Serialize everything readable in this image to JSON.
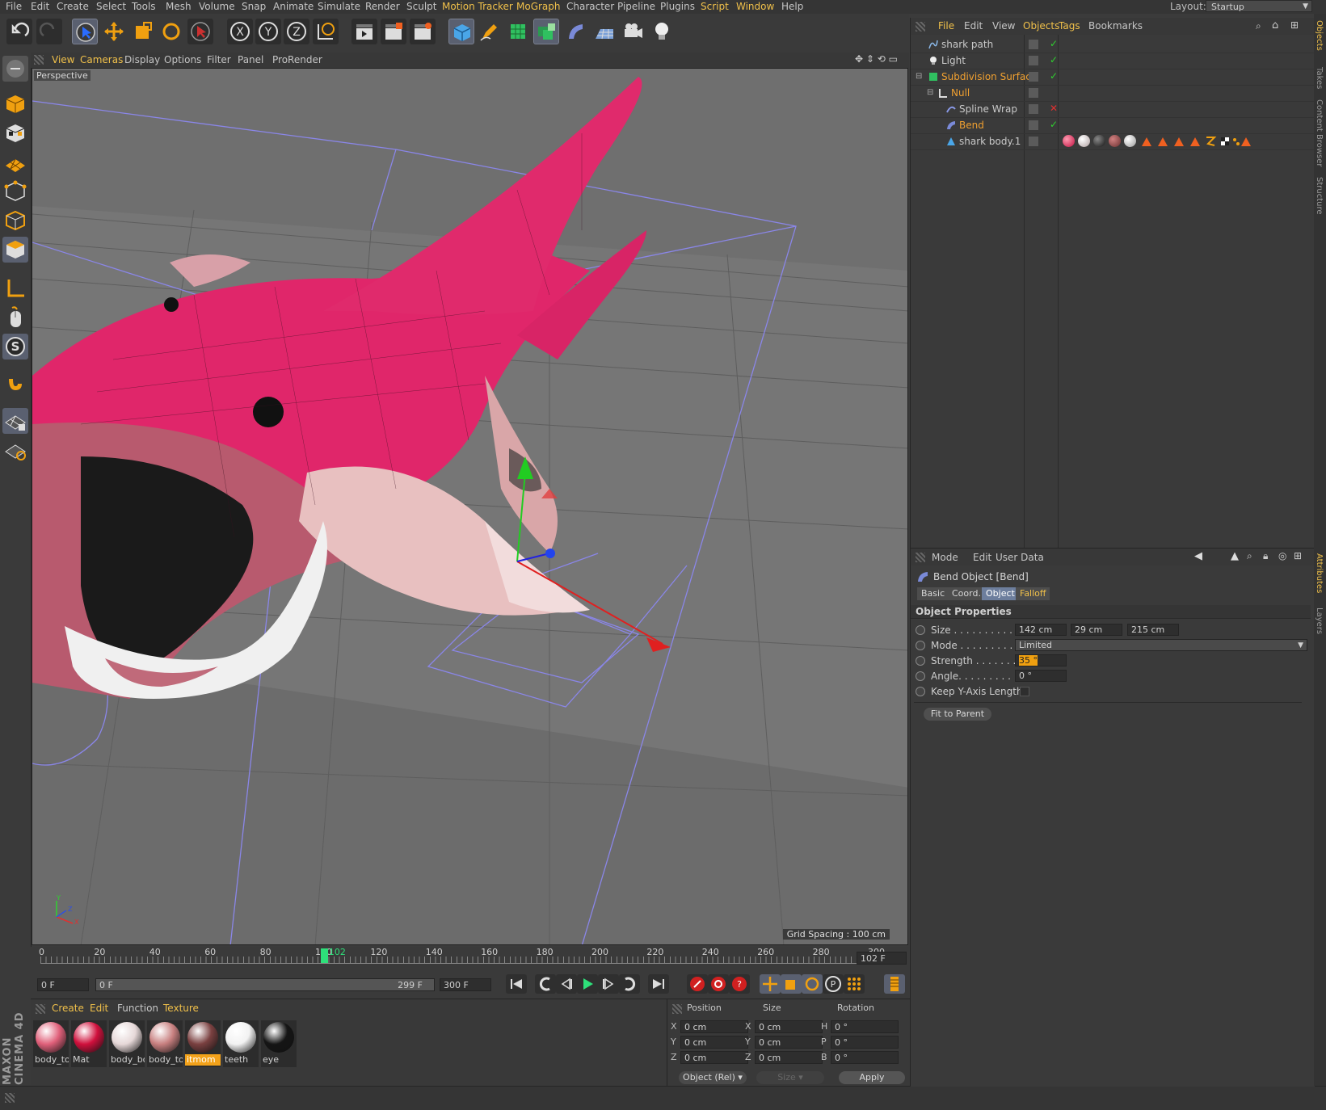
{
  "menubar": {
    "items": [
      "File",
      "Edit",
      "Create",
      "Select",
      "Tools",
      "Mesh",
      "Volume",
      "Snap",
      "Animate",
      "Simulate",
      "Render",
      "Sculpt",
      "Motion Tracker",
      "MoGraph",
      "Character",
      "Pipeline",
      "Plugins",
      "Script",
      "Window",
      "Help"
    ],
    "layout_label": "Layout:",
    "layout_value": "Startup"
  },
  "viewport": {
    "menu": [
      "View",
      "Cameras",
      "Display",
      "Options",
      "Filter",
      "Panel",
      "ProRender"
    ],
    "camera_label": "Perspective",
    "grid_spacing": "Grid Spacing : 100 cm",
    "axis_labels": {
      "y": "Y",
      "z": "Z",
      "x": "X"
    }
  },
  "timeline": {
    "ticks": [
      "0",
      "20",
      "40",
      "60",
      "80",
      "100",
      "120",
      "140",
      "160",
      "180",
      "200",
      "220",
      "240",
      "260",
      "280",
      "300"
    ],
    "current_frame_marker": "102",
    "current_frame_field": "102 F",
    "current_frame_value": 102,
    "max_frame_value": 300
  },
  "transport": {
    "start_field": "0 F",
    "range_start": "0 F",
    "range_end": "299 F",
    "end_field": "300 F"
  },
  "materials": {
    "menu": [
      "Create",
      "Edit",
      "Function",
      "Texture"
    ],
    "items": [
      {
        "label": "body_to",
        "color": "#e0607a"
      },
      {
        "label": "Mat",
        "color": "#d0103c"
      },
      {
        "label": "body_bo",
        "color": "#e6d8d8"
      },
      {
        "label": "body_to",
        "color": "#c88080"
      },
      {
        "label": "itmom",
        "color": "#7a4040"
      },
      {
        "label": "teeth",
        "color": "#f2f2f2"
      },
      {
        "label": "eye",
        "color": "#151515"
      }
    ]
  },
  "coordinates": {
    "headers": [
      "Position",
      "Size",
      "Rotation"
    ],
    "rows": [
      {
        "pl": "X",
        "pv": "0 cm",
        "sl": "X",
        "sv": "0 cm",
        "rl": "H",
        "rv": "0 °"
      },
      {
        "pl": "Y",
        "pv": "0 cm",
        "sl": "Y",
        "sv": "0 cm",
        "rl": "P",
        "rv": "0 °"
      },
      {
        "pl": "Z",
        "pv": "0 cm",
        "sl": "Z",
        "sv": "0 cm",
        "rl": "B",
        "rv": "0 °"
      }
    ],
    "mode": "Object (Rel)",
    "size_mode": "Size",
    "apply": "Apply"
  },
  "objects": {
    "menu": [
      "File",
      "Edit",
      "View",
      "Objects",
      "Tags",
      "Bookmarks"
    ],
    "items": [
      {
        "name": "shark path",
        "check": "✓"
      },
      {
        "name": "Light",
        "check": "✓"
      },
      {
        "name": "Subdivision Surface",
        "check": "✓"
      },
      {
        "name": "Null",
        "check": ""
      },
      {
        "name": "Spline Wrap",
        "check": "✕"
      },
      {
        "name": "Bend",
        "check": "✓"
      },
      {
        "name": "shark body.1",
        "check": ""
      }
    ]
  },
  "attributes": {
    "menu": [
      "Mode",
      "Edit",
      "User Data"
    ],
    "title": "Bend Object [Bend]",
    "tabs": [
      "Basic",
      "Coord.",
      "Object",
      "Falloff"
    ],
    "section": "Object Properties",
    "size_label": "Size . . . . . . . . . . . . . .",
    "size_values": [
      "142 cm",
      "29 cm",
      "215 cm"
    ],
    "mode_label": "Mode . . . . . . . . . . . . .",
    "mode_value": "Limited",
    "strength_label": "Strength . . . . . . . . . .",
    "strength_value": "35 °",
    "angle_label": "Angle. . . . . . . . . . . . .",
    "angle_value": "0 °",
    "keep_label": "Keep Y-Axis Length",
    "fit_button": "Fit to Parent"
  },
  "dock": {
    "objects_tabs": [
      "Objects",
      "Takes",
      "Content Browser",
      "Structure"
    ],
    "attr_tabs": [
      "Attributes",
      "Layers"
    ]
  },
  "branding": "MAXON CINEMA 4D",
  "colors": {
    "accent": "#f0c04a",
    "selection": "#f0a030",
    "shark_pink": "#e0266a",
    "viewport_bg": "#6f6f6f"
  }
}
